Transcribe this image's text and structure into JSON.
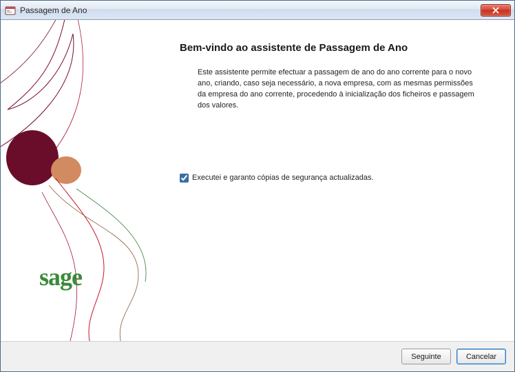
{
  "window": {
    "title": "Passagem de Ano"
  },
  "content": {
    "heading": "Bem-vindo ao assistente de Passagem de Ano",
    "paragraph": "Este assistente permite efectuar a passagem de ano do ano corrente para o novo ano, criando, caso seja necessário, a nova empresa, com as mesmas permissões da empresa do ano corrente, procedendo à inicialização dos ficheiros e  passagem dos valores.",
    "checkbox_label": "Executei e garanto cópias de segurança actualizadas.",
    "checkbox_checked": true
  },
  "logo": {
    "text": "sage"
  },
  "buttons": {
    "next": "Seguinte",
    "cancel": "Cancelar"
  }
}
